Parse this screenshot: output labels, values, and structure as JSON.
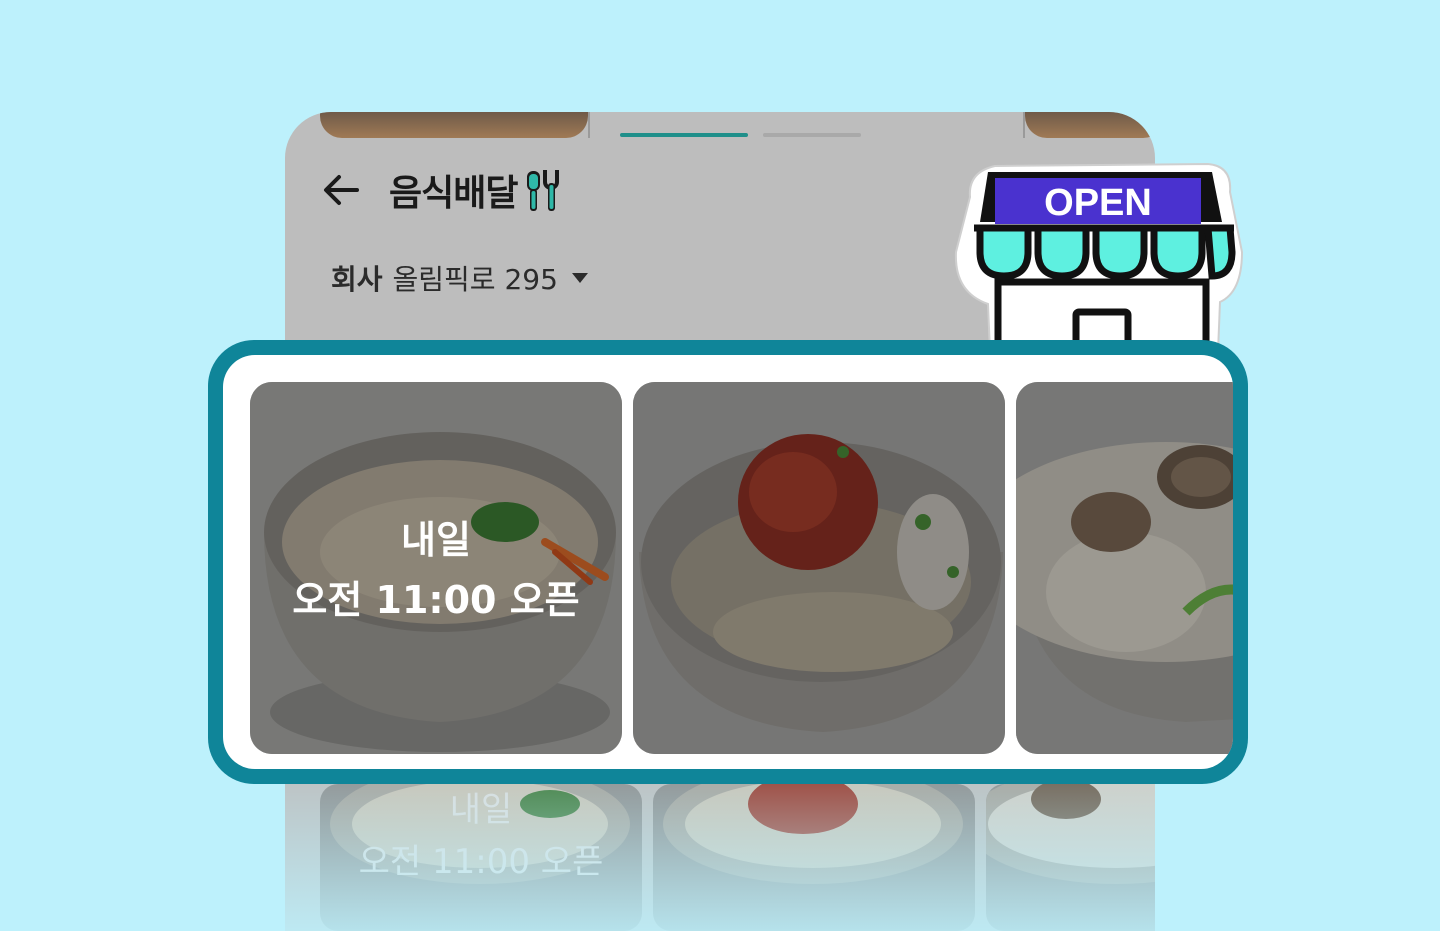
{
  "header": {
    "title": "음식배달",
    "back_icon": "arrow-left-icon",
    "title_icon": "cutlery-icon"
  },
  "address": {
    "label": "회사",
    "value": "올림픽로 295",
    "dropdown_icon": "caret-down-icon"
  },
  "store_badge": {
    "text": "OPEN",
    "icon": "storefront-icon"
  },
  "restaurants": [
    {
      "image": "janchi-noodle-soup",
      "status_day": "내일",
      "status_time": "오전 11:00 오픈"
    },
    {
      "image": "spicy-bibim-noodles",
      "status_day": "",
      "status_time": ""
    },
    {
      "image": "clam-kalguksu",
      "status_day": "",
      "status_time": ""
    }
  ],
  "colors": {
    "background": "#bdf1fc",
    "accent": "#0f8599",
    "mint": "#5ef0e0",
    "badge": "#4a32cf"
  }
}
